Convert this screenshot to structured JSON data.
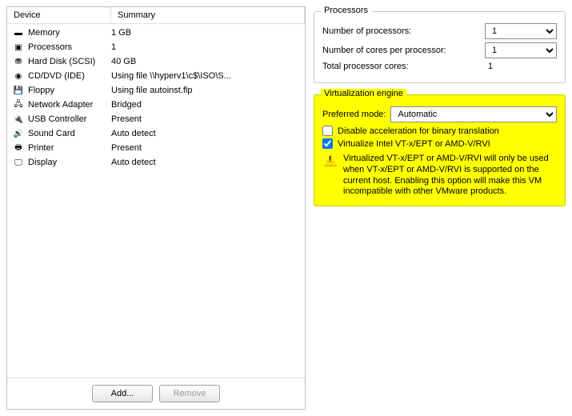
{
  "columns": {
    "device": "Device",
    "summary": "Summary"
  },
  "devices": [
    {
      "icon": "memory-icon",
      "name": "Memory",
      "summary": "1 GB"
    },
    {
      "icon": "cpu-icon",
      "name": "Processors",
      "summary": "1"
    },
    {
      "icon": "hdd-icon",
      "name": "Hard Disk (SCSI)",
      "summary": "40 GB"
    },
    {
      "icon": "cdrom-icon",
      "name": "CD/DVD (IDE)",
      "summary": "Using file \\\\hyperv1\\c$\\ISO\\S..."
    },
    {
      "icon": "floppy-icon",
      "name": "Floppy",
      "summary": "Using file autoinst.flp"
    },
    {
      "icon": "nic-icon",
      "name": "Network Adapter",
      "summary": "Bridged"
    },
    {
      "icon": "usb-icon",
      "name": "USB Controller",
      "summary": "Present"
    },
    {
      "icon": "sound-icon",
      "name": "Sound Card",
      "summary": "Auto detect"
    },
    {
      "icon": "printer-icon",
      "name": "Printer",
      "summary": "Present"
    },
    {
      "icon": "display-icon",
      "name": "Display",
      "summary": "Auto detect"
    }
  ],
  "buttons": {
    "add": "Add...",
    "remove": "Remove"
  },
  "processors_group": {
    "legend": "Processors",
    "num_proc_label": "Number of processors:",
    "num_proc_value": "1",
    "cores_label": "Number of cores per processor:",
    "cores_value": "1",
    "total_label": "Total processor cores:",
    "total_value": "1"
  },
  "virt_group": {
    "legend": "Virtualization engine",
    "preferred_label": "Preferred mode:",
    "preferred_value": "Automatic",
    "chk_disable_accel": {
      "label": "Disable acceleration for binary translation",
      "checked": false
    },
    "chk_virt_intel": {
      "label": "Virtualize Intel VT-x/EPT or AMD-V/RVI",
      "checked": true
    },
    "warning": "Virtualized VT-x/EPT or AMD-V/RVI will only be used when VT-x/EPT or AMD-V/RVI is supported on the current host. Enabling this option will make this VM incompatible with other VMware products."
  },
  "icon_glyphs": {
    "memory-icon": "▬",
    "cpu-icon": "▣",
    "hdd-icon": "⛃",
    "cdrom-icon": "◉",
    "floppy-icon": "💾",
    "nic-icon": "🖧",
    "usb-icon": "🔌",
    "sound-icon": "🔊",
    "printer-icon": "🖶",
    "display-icon": "🖵"
  }
}
